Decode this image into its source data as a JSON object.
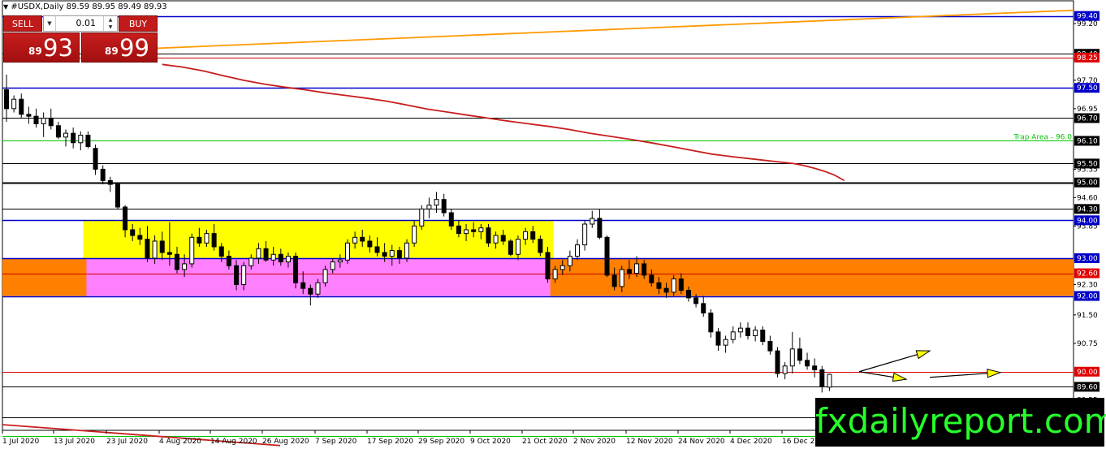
{
  "header": {
    "symbol": "#USDX,Daily",
    "ohlc": "89.59 89.95 89.49 89.93"
  },
  "trade_panel": {
    "sell_label": "SELL",
    "buy_label": "BUY",
    "lot": "0.01",
    "sell_small": "89",
    "sell_big": "93",
    "buy_small": "89",
    "buy_big": "99"
  },
  "watermark": "fxdailyreport.com",
  "colors": {
    "bull_candle": "#ffffff",
    "bear_candle": "#000000",
    "yellow_zone": "#ffff00",
    "pink_zone": "#ff80ff",
    "orange_zone": "#ff8000",
    "ma_line": "#c81e1e",
    "upper_trend": "#ff9900",
    "blue_level": "#0000c8",
    "green_level": "#00c800",
    "red_level": "#e00000",
    "arrow": "#ffff00"
  },
  "chart_data": {
    "type": "candlestick",
    "x_labels": [
      "1 Jul 2020",
      "13 Jul 2020",
      "23 Jul 2020",
      "4 Aug 2020",
      "14 Aug 2020",
      "26 Aug 2020",
      "7 Sep 2020",
      "17 Sep 2020",
      "29 Sep 2020",
      "9 Oct 2020",
      "21 Oct 2020",
      "2 Nov 2020",
      "12 Nov 2020",
      "24 Nov 2020",
      "4 Dec 2020",
      "16 Dec 2020"
    ],
    "y_tick_labels": [
      "99.20",
      "98.25",
      "97.70",
      "96.95",
      "95.35",
      "94.60",
      "93.85",
      "92.30",
      "91.50",
      "90.75",
      "89.25"
    ],
    "ylim": [
      88.45,
      99.8
    ],
    "levels": [
      {
        "price": 99.4,
        "label": "99.40",
        "color": "#0000c8",
        "tag": "blue"
      },
      {
        "price": 98.4,
        "label": "98.40",
        "color": "#000000",
        "tag": "black"
      },
      {
        "price": 98.3,
        "label": "98.25",
        "color": "#cc0000",
        "tag": "red"
      },
      {
        "price": 97.5,
        "label": "97.50",
        "color": "#0000c8",
        "tag": "blue"
      },
      {
        "price": 96.7,
        "label": "96.70",
        "color": "#000000",
        "tag": "black"
      },
      {
        "price": 96.1,
        "label": "96.10",
        "color": "#00c800",
        "tag": "black",
        "note": "Trap Area - 96.0"
      },
      {
        "price": 95.5,
        "label": "95.50",
        "color": "#000000",
        "tag": "black"
      },
      {
        "price": 95.0,
        "label": "95.00",
        "color": "#000000",
        "tag": "black"
      },
      {
        "price": 94.3,
        "label": "94.30",
        "color": "#000000",
        "tag": "black"
      },
      {
        "price": 94.0,
        "label": "94.00",
        "color": "#0000c8",
        "tag": "blue"
      },
      {
        "price": 93.0,
        "label": "93.00",
        "color": "#0000c8",
        "tag": "blue"
      },
      {
        "price": 92.6,
        "label": "92.60",
        "color": "#cc0000",
        "tag": "red"
      },
      {
        "price": 92.0,
        "label": "92.00",
        "color": "#0000c8",
        "tag": "blue"
      },
      {
        "price": 90.0,
        "label": "90.00",
        "color": "#e00000",
        "tag": "red"
      },
      {
        "price": 89.6,
        "label": "89.60",
        "color": "#000000",
        "tag": "black"
      },
      {
        "price": 88.8,
        "label": "88.80",
        "color": "#000000",
        "tag": "black"
      },
      {
        "price": 88.3,
        "label": "",
        "color": "#00c800",
        "tag": "none"
      }
    ],
    "zones": [
      {
        "name": "yellow",
        "from_bar": 11,
        "to_bar": 74,
        "low": 93.0,
        "high": 94.0,
        "color": "#ffff00"
      },
      {
        "name": "pink",
        "from_bar": 11,
        "to_bar": 74,
        "low": 92.0,
        "high": 93.0,
        "color": "#ff80ff"
      },
      {
        "name": "orange-left",
        "from_bar": 0,
        "to_bar": 11,
        "low": 92.0,
        "high": 93.0,
        "color": "#ff8000"
      },
      {
        "name": "orange-right",
        "from_bar": 74,
        "to_bar": 104,
        "low": 92.0,
        "high": 93.0,
        "color": "#ff8000"
      }
    ],
    "candles": [
      [
        97.45,
        97.85,
        96.6,
        96.95
      ],
      [
        96.95,
        97.3,
        96.85,
        97.2
      ],
      [
        97.2,
        97.35,
        96.7,
        96.8
      ],
      [
        96.8,
        97.0,
        96.55,
        96.75
      ],
      [
        96.75,
        96.95,
        96.45,
        96.55
      ],
      [
        96.55,
        96.85,
        96.2,
        96.7
      ],
      [
        96.7,
        96.95,
        96.4,
        96.5
      ],
      [
        96.5,
        96.6,
        96.15,
        96.2
      ],
      [
        96.2,
        96.4,
        95.95,
        96.3
      ],
      [
        96.3,
        96.45,
        95.9,
        96.05
      ],
      [
        96.05,
        96.35,
        95.85,
        96.25
      ],
      [
        96.25,
        96.35,
        95.9,
        95.95
      ],
      [
        95.9,
        96.0,
        95.2,
        95.35
      ],
      [
        95.35,
        95.45,
        94.95,
        95.05
      ],
      [
        95.05,
        95.15,
        94.75,
        94.95
      ],
      [
        94.95,
        95.0,
        94.3,
        94.35
      ],
      [
        94.35,
        94.4,
        93.55,
        93.75
      ],
      [
        93.75,
        93.9,
        93.45,
        93.6
      ],
      [
        93.6,
        93.8,
        93.35,
        93.5
      ],
      [
        93.5,
        93.85,
        92.9,
        93.0
      ],
      [
        93.0,
        93.6,
        92.85,
        93.45
      ],
      [
        93.45,
        93.7,
        92.95,
        93.15
      ],
      [
        93.15,
        93.95,
        92.8,
        93.1
      ],
      [
        93.1,
        93.3,
        92.6,
        92.7
      ],
      [
        92.7,
        93.1,
        92.5,
        92.85
      ],
      [
        92.85,
        93.65,
        92.75,
        93.55
      ],
      [
        93.55,
        93.8,
        93.3,
        93.4
      ],
      [
        93.4,
        93.75,
        93.3,
        93.65
      ],
      [
        93.65,
        93.9,
        93.2,
        93.3
      ],
      [
        93.3,
        93.4,
        92.9,
        93.05
      ],
      [
        93.05,
        93.2,
        92.7,
        92.8
      ],
      [
        92.8,
        92.95,
        92.15,
        92.3
      ],
      [
        92.3,
        92.9,
        92.15,
        92.8
      ],
      [
        92.8,
        93.1,
        92.7,
        93.0
      ],
      [
        93.0,
        93.4,
        92.85,
        93.25
      ],
      [
        93.25,
        93.45,
        92.9,
        92.95
      ],
      [
        92.95,
        93.3,
        92.8,
        93.1
      ],
      [
        93.1,
        93.25,
        92.8,
        92.9
      ],
      [
        92.9,
        93.15,
        92.75,
        93.05
      ],
      [
        93.05,
        93.15,
        92.2,
        92.35
      ],
      [
        92.35,
        92.65,
        92.05,
        92.2
      ],
      [
        92.2,
        92.3,
        91.75,
        92.05
      ],
      [
        92.05,
        92.45,
        91.95,
        92.35
      ],
      [
        92.35,
        92.8,
        92.25,
        92.7
      ],
      [
        92.7,
        93.0,
        92.6,
        92.9
      ],
      [
        92.9,
        93.1,
        92.75,
        92.95
      ],
      [
        92.95,
        93.5,
        92.85,
        93.4
      ],
      [
        93.4,
        93.7,
        93.25,
        93.55
      ],
      [
        93.55,
        93.75,
        93.3,
        93.45
      ],
      [
        93.45,
        93.6,
        93.15,
        93.3
      ],
      [
        93.3,
        93.55,
        93.05,
        93.15
      ],
      [
        93.15,
        93.4,
        92.9,
        93.05
      ],
      [
        93.05,
        93.35,
        92.8,
        93.2
      ],
      [
        93.2,
        93.3,
        92.85,
        93.0
      ],
      [
        93.0,
        93.5,
        92.9,
        93.4
      ],
      [
        93.4,
        94.0,
        93.3,
        93.85
      ],
      [
        93.85,
        94.4,
        93.75,
        94.3
      ],
      [
        94.3,
        94.6,
        94.05,
        94.4
      ],
      [
        94.4,
        94.75,
        94.2,
        94.55
      ],
      [
        94.55,
        94.7,
        94.1,
        94.2
      ],
      [
        94.2,
        94.3,
        93.75,
        93.85
      ],
      [
        93.85,
        94.0,
        93.55,
        93.65
      ],
      [
        93.65,
        93.9,
        93.45,
        93.75
      ],
      [
        93.75,
        93.95,
        93.55,
        93.7
      ],
      [
        93.7,
        93.9,
        93.5,
        93.8
      ],
      [
        93.8,
        93.9,
        93.3,
        93.4
      ],
      [
        93.4,
        93.7,
        93.25,
        93.6
      ],
      [
        93.6,
        93.75,
        93.35,
        93.45
      ],
      [
        93.45,
        93.5,
        93.05,
        93.1
      ],
      [
        93.1,
        93.6,
        92.95,
        93.5
      ],
      [
        93.5,
        93.8,
        93.35,
        93.7
      ],
      [
        93.7,
        93.85,
        93.4,
        93.5
      ],
      [
        93.5,
        93.6,
        93.05,
        93.15
      ],
      [
        93.15,
        93.3,
        92.35,
        92.45
      ],
      [
        92.45,
        92.8,
        92.35,
        92.7
      ],
      [
        92.7,
        92.95,
        92.55,
        92.8
      ],
      [
        92.8,
        93.2,
        92.65,
        93.05
      ],
      [
        93.05,
        93.5,
        92.95,
        93.35
      ],
      [
        93.35,
        94.0,
        93.2,
        93.9
      ],
      [
        93.9,
        94.25,
        93.8,
        94.05
      ],
      [
        94.05,
        94.3,
        93.5,
        93.55
      ],
      [
        93.55,
        93.6,
        92.5,
        92.55
      ],
      [
        92.55,
        92.75,
        92.15,
        92.25
      ],
      [
        92.25,
        92.8,
        92.1,
        92.7
      ],
      [
        92.7,
        92.95,
        92.45,
        92.6
      ],
      [
        92.6,
        93.05,
        92.5,
        92.85
      ],
      [
        92.85,
        92.95,
        92.45,
        92.55
      ],
      [
        92.55,
        92.7,
        92.25,
        92.35
      ],
      [
        92.35,
        92.5,
        92.05,
        92.2
      ],
      [
        92.2,
        92.35,
        91.95,
        92.1
      ],
      [
        92.1,
        92.55,
        92.0,
        92.45
      ],
      [
        92.45,
        92.6,
        92.05,
        92.15
      ],
      [
        92.15,
        92.25,
        91.85,
        91.95
      ],
      [
        91.95,
        92.05,
        91.7,
        91.8
      ],
      [
        91.8,
        92.0,
        91.45,
        91.55
      ],
      [
        91.55,
        91.65,
        90.9,
        91.05
      ],
      [
        91.05,
        91.15,
        90.55,
        90.7
      ],
      [
        90.7,
        90.95,
        90.5,
        90.85
      ],
      [
        90.85,
        91.2,
        90.75,
        91.05
      ],
      [
        91.05,
        91.3,
        90.9,
        91.15
      ],
      [
        91.15,
        91.3,
        90.85,
        90.95
      ],
      [
        90.95,
        91.2,
        90.8,
        91.1
      ],
      [
        91.1,
        91.2,
        90.7,
        90.8
      ],
      [
        90.8,
        90.95,
        90.45,
        90.55
      ],
      [
        90.55,
        90.65,
        89.85,
        89.95
      ],
      [
        89.95,
        90.25,
        89.8,
        90.15
      ],
      [
        90.15,
        91.05,
        89.95,
        90.6
      ],
      [
        90.6,
        90.9,
        90.2,
        90.3
      ],
      [
        90.3,
        90.5,
        90.05,
        90.15
      ],
      [
        90.15,
        90.35,
        89.85,
        90.05
      ],
      [
        90.05,
        90.15,
        89.45,
        89.6
      ],
      [
        89.59,
        89.95,
        89.49,
        89.93
      ]
    ],
    "ma_series": [
      [
        4,
        98.12
      ],
      [
        6,
        98.05
      ],
      [
        8,
        97.95
      ],
      [
        10,
        97.82
      ],
      [
        12,
        97.7
      ],
      [
        14,
        97.6
      ],
      [
        16,
        97.52
      ],
      [
        18,
        97.45
      ],
      [
        20,
        97.37
      ],
      [
        22,
        97.3
      ],
      [
        24,
        97.23
      ],
      [
        26,
        97.15
      ],
      [
        28,
        97.05
      ],
      [
        30,
        96.94
      ],
      [
        32,
        96.86
      ],
      [
        34,
        96.78
      ],
      [
        36,
        96.7
      ],
      [
        38,
        96.62
      ],
      [
        40,
        96.55
      ],
      [
        42,
        96.48
      ],
      [
        44,
        96.4
      ],
      [
        46,
        96.3
      ],
      [
        48,
        96.22
      ],
      [
        50,
        96.14
      ],
      [
        52,
        96.05
      ],
      [
        54,
        95.95
      ],
      [
        56,
        95.85
      ],
      [
        58,
        95.75
      ],
      [
        60,
        95.68
      ],
      [
        62,
        95.62
      ],
      [
        64,
        95.56
      ],
      [
        66,
        95.5
      ],
      [
        67,
        95.45
      ],
      [
        68,
        95.38
      ],
      [
        69,
        95.3
      ],
      [
        70,
        95.2
      ],
      [
        71,
        95.05
      ]
    ],
    "upper_trend": {
      "from": [
        11,
        98.48
      ],
      "to": [
        104,
        99.55
      ],
      "color": "#ff9900"
    },
    "lower_trend": {
      "from": [
        0,
        88.6
      ],
      "to": [
        30,
        88.22
      ],
      "color": "#c81e1e"
    },
    "arrows": [
      {
        "from": [
          77,
          90.0
        ],
        "to": [
          80,
          90.55
        ]
      },
      {
        "from": [
          77,
          90.0
        ],
        "to": [
          79,
          89.8
        ]
      },
      {
        "from": [
          80,
          89.85
        ],
        "to": [
          83,
          89.98
        ]
      }
    ]
  }
}
